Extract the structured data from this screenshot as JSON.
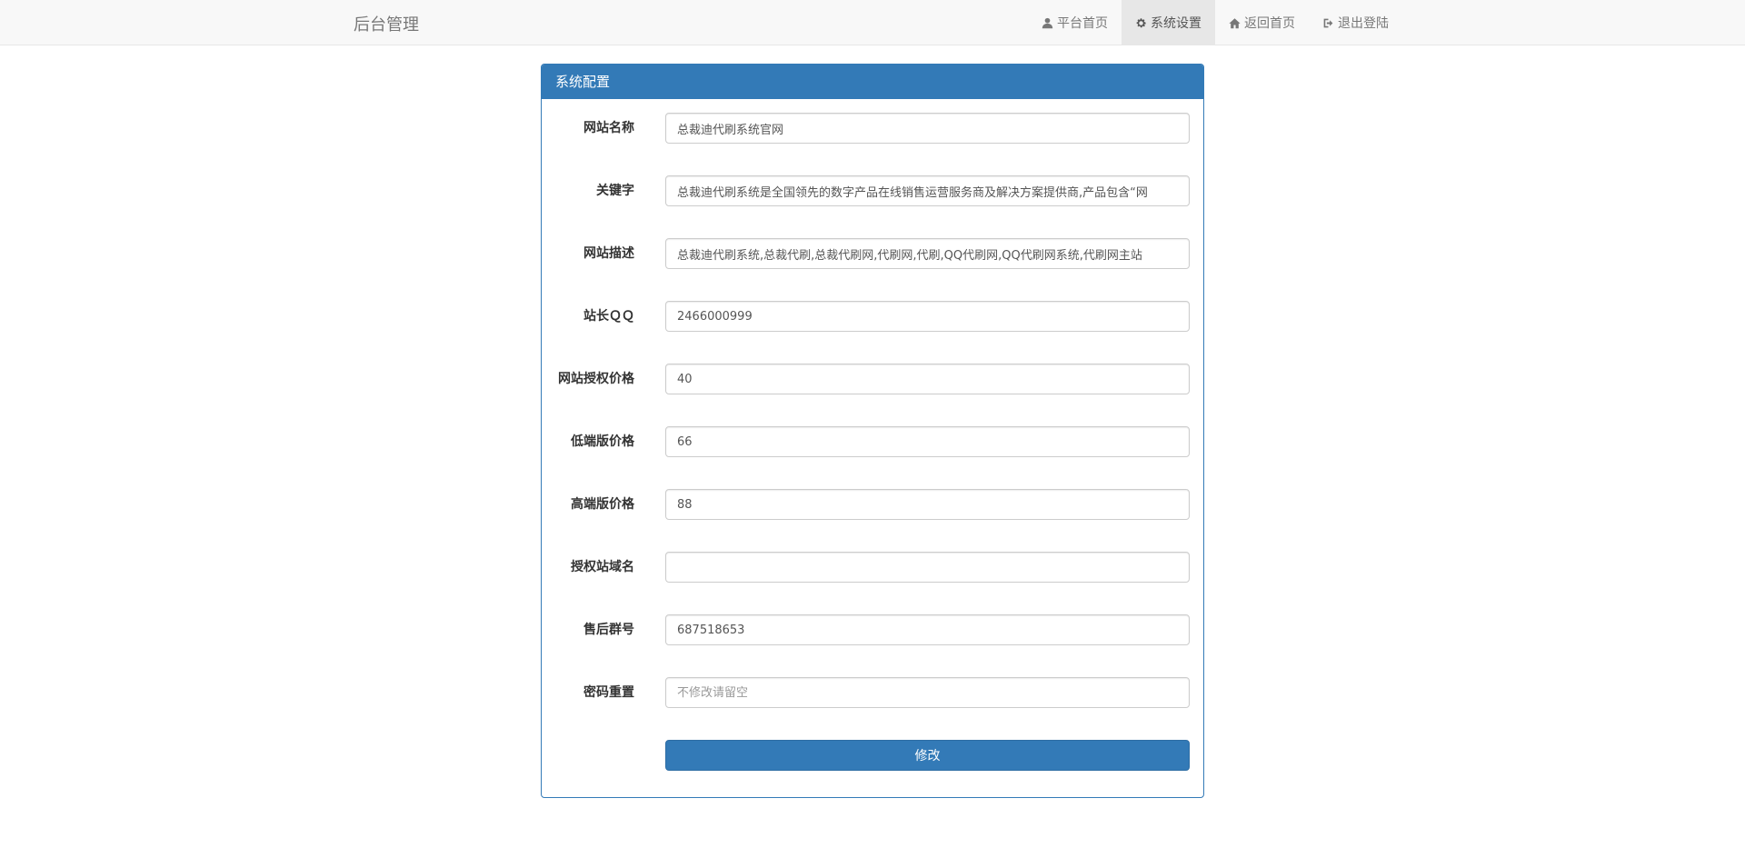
{
  "navbar": {
    "brand": "后台管理",
    "items": [
      {
        "label": "平台首页",
        "icon": "user-icon",
        "active": false
      },
      {
        "label": "系统设置",
        "icon": "gear-icon",
        "active": true
      },
      {
        "label": "返回首页",
        "icon": "home-icon",
        "active": false
      },
      {
        "label": "退出登陆",
        "icon": "logout-icon",
        "active": false
      }
    ]
  },
  "panel": {
    "title": "系统配置",
    "fields": [
      {
        "label": "网站名称",
        "value": "总裁迪代刷系统官网",
        "placeholder": ""
      },
      {
        "label": "关键字",
        "value": "总裁迪代刷系统是全国领先的数字产品在线销售运营服务商及解决方案提供商,产品包含“网",
        "placeholder": ""
      },
      {
        "label": "网站描述",
        "value": "总裁迪代刷系统,总裁代刷,总裁代刷网,代刷网,代刷,QQ代刷网,QQ代刷网系统,代刷网主站",
        "placeholder": ""
      },
      {
        "label": "站长ＱＱ",
        "value": "2466000999",
        "placeholder": ""
      },
      {
        "label": "网站授权价格",
        "value": "40",
        "placeholder": ""
      },
      {
        "label": "低端版价格",
        "value": "66",
        "placeholder": ""
      },
      {
        "label": "高端版价格",
        "value": "88",
        "placeholder": ""
      },
      {
        "label": "授权站域名",
        "value": "",
        "placeholder": ""
      },
      {
        "label": "售后群号",
        "value": "687518653",
        "placeholder": ""
      },
      {
        "label": "密码重置",
        "value": "",
        "placeholder": "不修改请留空"
      }
    ],
    "submit_label": "修改"
  },
  "colors": {
    "primary": "#337ab7",
    "navbar_bg": "#f8f8f8",
    "nav_active_bg": "#e7e7e7"
  }
}
